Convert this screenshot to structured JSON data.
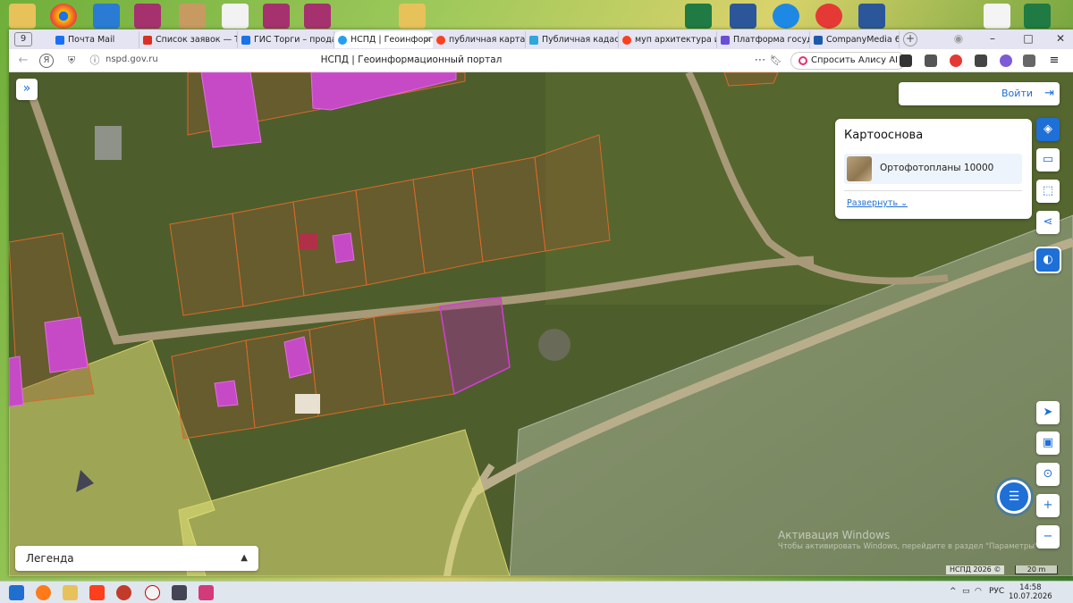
{
  "browser": {
    "tab_count": "9",
    "tabs": [
      {
        "label": "Почта Mail",
        "color": "#1b6ff5"
      },
      {
        "label": "Список заявок — Те",
        "color": "#d93025"
      },
      {
        "label": "ГИС Торги – продаж",
        "color": "#1a73e8"
      },
      {
        "label": "НСПД | Геоинфорг",
        "color": "#24a0ed"
      },
      {
        "label": "публичная карта зе",
        "color": "#fc3f1d"
      },
      {
        "label": "Публичная кадастр",
        "color": "#2fa7d9"
      },
      {
        "label": "муп архитектура ис",
        "color": "#fc3f1d"
      },
      {
        "label": "Платформа государ",
        "color": "#6a4fd6"
      },
      {
        "label": "CompanyMedia 6.3.1",
        "color": "#1e5aa8"
      }
    ],
    "window_controls": {
      "minimize": "–",
      "maximize": "□",
      "close": "✕"
    },
    "url": "nspd.gov.ru",
    "page_title": "НСПД | Геоинформационный портал",
    "alice_label": "Спросить Алису AI"
  },
  "map": {
    "login_label": "Войти",
    "basemap": {
      "title": "Картооснова",
      "selected": "Ортофотопланы 10000",
      "expand_label": "Развернуть"
    },
    "legend_label": "Легенда",
    "watermark_title": "Активация Windows",
    "watermark_subtitle": "Чтобы активировать Windows, перейдите в раздел \"Параметры\".",
    "copyright": "НСПД 2026 ©",
    "scale_label": "20 m",
    "zoom_in": "+",
    "zoom_out": "−"
  },
  "taskbar": {
    "language": "РУС",
    "time": "14:58",
    "date": "10.07.2026"
  }
}
